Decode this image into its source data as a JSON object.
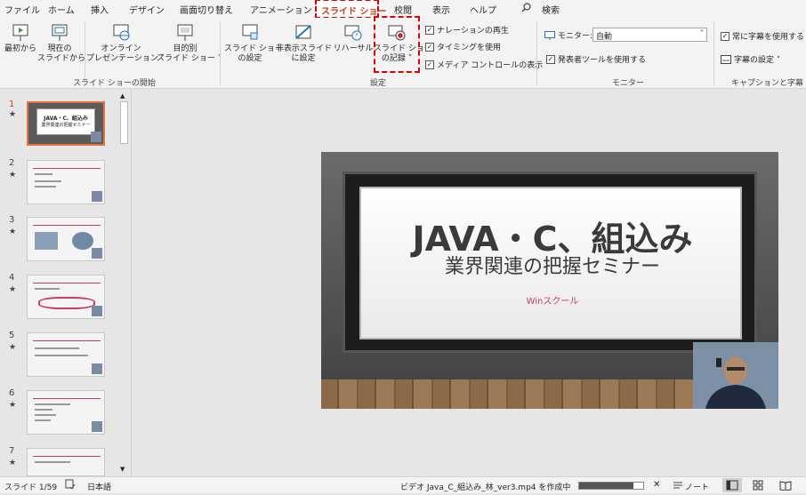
{
  "menu": {
    "tabs": [
      "ファイル",
      "ホーム",
      "挿入",
      "デザイン",
      "画面切り替え",
      "アニメーション",
      "スライド ショー",
      "校閲",
      "表示",
      "ヘルプ"
    ],
    "active_tab": "スライド ショー",
    "search_label": "検索"
  },
  "ribbon": {
    "start_group": {
      "label": "スライド ショーの開始",
      "from_beginning": "最初から",
      "from_current_1": "現在の",
      "from_current_2": "スライドから",
      "online_1": "オンライン",
      "online_2": "プレゼンテーション ˅",
      "custom_1": "目的別",
      "custom_2": "スライド ショー ˅"
    },
    "setup_group": {
      "label": "設定",
      "setup_1": "スライド ショー",
      "setup_2": "の設定",
      "hide_1": "非表示スライド",
      "hide_2": "に設定",
      "rehearse": "リハーサル",
      "record_1": "スライド ショー",
      "record_2": "の記録 ˅",
      "narration": "ナレーションの再生",
      "timing": "タイミングを使用",
      "media": "メディア コントロールの表示"
    },
    "monitor_group": {
      "label": "モニター",
      "monitor_label": "モニター:",
      "monitor_value": "自動",
      "presenter": "発表者ツールを使用する"
    },
    "caption_group": {
      "label": "キャプションと字幕",
      "always": "常に字幕を使用する",
      "settings": "字幕の設定 ˅"
    }
  },
  "slides": [
    {
      "num": "1",
      "star": "★"
    },
    {
      "num": "2",
      "star": "★"
    },
    {
      "num": "3",
      "star": "★"
    },
    {
      "num": "4",
      "star": "★"
    },
    {
      "num": "5",
      "star": "★"
    },
    {
      "num": "6",
      "star": "★"
    },
    {
      "num": "7",
      "star": "★"
    }
  ],
  "current_slide": {
    "title": "JAVA・C、組込み",
    "subtitle": "業界関連の把握セミナー",
    "brand": "Winスクール"
  },
  "thumb1": {
    "title": "JAVA・C、組込み",
    "subtitle": "業界関連の把握セミナー"
  },
  "status": {
    "slide_info": "スライド 1/59",
    "language": "日本語",
    "video_task": "ビデオ Java_C_組込み_林_ver3.mp4 を作成中",
    "progress": 0.85,
    "notes": "ノート"
  },
  "colors": {
    "accent": "#c43e1c",
    "highlight_dash": "#e00000",
    "brand": "#c43a74"
  }
}
